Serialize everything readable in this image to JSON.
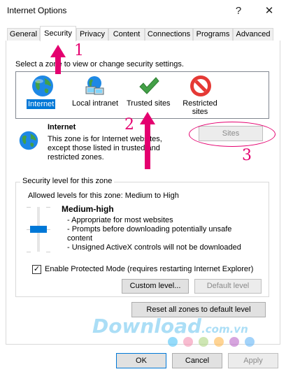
{
  "window": {
    "title": "Internet Options",
    "help": "?",
    "close": "✕"
  },
  "tabs": [
    {
      "label": "General"
    },
    {
      "label": "Security"
    },
    {
      "label": "Privacy"
    },
    {
      "label": "Content"
    },
    {
      "label": "Connections"
    },
    {
      "label": "Programs"
    },
    {
      "label": "Advanced"
    }
  ],
  "security": {
    "select_zone_text": "Select a zone to view or change security settings.",
    "zones": [
      {
        "label": "Internet",
        "icon": "globe-icon",
        "selected": true
      },
      {
        "label": "Local intranet",
        "icon": "intranet-icon"
      },
      {
        "label": "Trusted sites",
        "icon": "checkmark-icon"
      },
      {
        "label": "Restricted sites",
        "icon": "no-entry-icon"
      }
    ],
    "zone_title": "Internet",
    "zone_desc": "This zone is for Internet websites, except those listed in trusted and restricted zones.",
    "sites_button": "Sites",
    "level_group_title": "Security level for this zone",
    "allowed_levels": "Allowed levels for this zone: Medium to High",
    "level_name": "Medium-high",
    "level_bullets": [
      "- Appropriate for most websites",
      "- Prompts before downloading potentially unsafe content",
      "- Unsigned ActiveX controls will not be downloaded"
    ],
    "slider_level_fraction": 0.5,
    "protected_mode": {
      "label": "Enable Protected Mode (requires restarting Internet Explorer)",
      "checked": true
    },
    "custom_level_button": "Custom level...",
    "default_level_button": "Default level",
    "reset_button": "Reset all zones to default level"
  },
  "footer": {
    "ok": "OK",
    "cancel": "Cancel",
    "apply": "Apply"
  },
  "annotations": {
    "n1": "1",
    "n2": "2",
    "n3": "3",
    "color": "#e4006f"
  },
  "watermark": {
    "text": "Download",
    "suffix": ".com.vn",
    "dot_colors": [
      "#4fc3f7",
      "#f48fb1",
      "#aed581",
      "#ffb74d",
      "#ba68c8",
      "#64b5f6"
    ]
  }
}
